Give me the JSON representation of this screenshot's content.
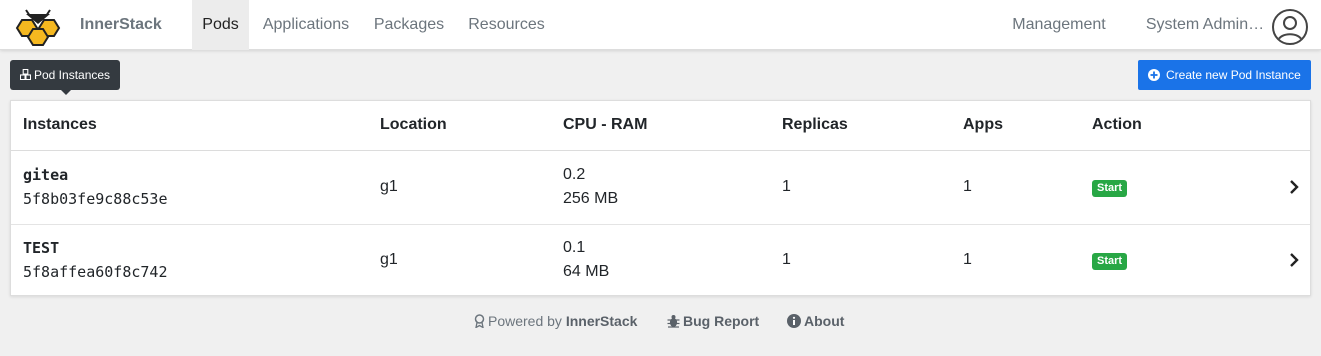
{
  "brand": {
    "name": "InnerStack"
  },
  "nav": {
    "items": [
      {
        "label": "Pods",
        "active": true
      },
      {
        "label": "Applications",
        "active": false
      },
      {
        "label": "Packages",
        "active": false
      },
      {
        "label": "Resources",
        "active": false
      }
    ],
    "right": [
      {
        "label": "Management"
      },
      {
        "label": "System Admin…"
      }
    ]
  },
  "toolbar": {
    "section_label": "Pod Instances",
    "create_label": "Create new Pod Instance"
  },
  "table": {
    "headers": [
      "Instances",
      "Location",
      "CPU - RAM",
      "Replicas",
      "Apps",
      "Action"
    ],
    "rows": [
      {
        "name": "gitea",
        "id": "5f8b03fe9c88c53e",
        "location": "g1",
        "cpu": "0.2",
        "ram": "256 MB",
        "replicas": "1",
        "apps": "1",
        "action": "Start"
      },
      {
        "name": "TEST",
        "id": "5f8affea60f8c742",
        "location": "g1",
        "cpu": "0.1",
        "ram": "64 MB",
        "replicas": "1",
        "apps": "1",
        "action": "Start"
      }
    ]
  },
  "footer": {
    "powered_prefix": "Powered by",
    "powered_name": "InnerStack",
    "bug_report": "Bug Report",
    "about": "About"
  },
  "colors": {
    "primary": "#1a73e8",
    "success": "#28a745",
    "tag_bg": "#343a40",
    "logo_fill": "#f5b820"
  },
  "icons": [
    "bee-logo-icon",
    "user-avatar-icon",
    "cubes-icon",
    "plus-circle-icon",
    "chevron-right-icon",
    "award-icon",
    "bug-icon",
    "info-circle-icon"
  ]
}
